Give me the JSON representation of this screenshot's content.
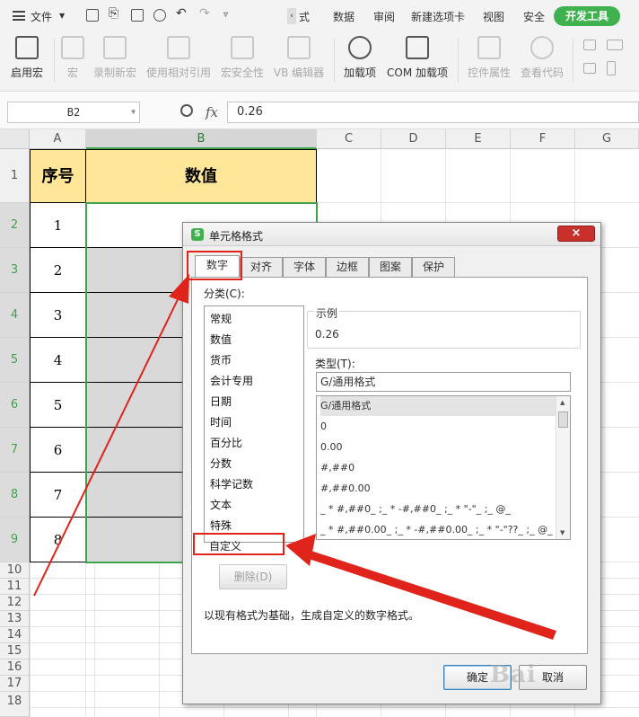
{
  "menubar": {
    "file_label": "文件",
    "tabs": [
      "式",
      "数据",
      "审阅",
      "新建选项卡",
      "视图",
      "安全"
    ],
    "active_tab": "开发工具"
  },
  "ribbon": {
    "buttons": [
      {
        "label": "启用宏",
        "enabled": true
      },
      {
        "label": "宏",
        "enabled": false
      },
      {
        "label": "录制新宏",
        "enabled": false
      },
      {
        "label": "使用相对引用",
        "enabled": false
      },
      {
        "label": "宏安全性",
        "enabled": false
      },
      {
        "label": "VB 编辑器",
        "enabled": false
      },
      {
        "label": "加载项",
        "enabled": true
      },
      {
        "label": "COM 加载项",
        "enabled": true
      },
      {
        "label": "控件属性",
        "enabled": false
      },
      {
        "label": "查看代码",
        "enabled": false
      }
    ]
  },
  "formula_bar": {
    "cell_ref": "B2",
    "fx_label": "fx",
    "value": "0.26"
  },
  "sheet": {
    "columns": [
      "A",
      "B",
      "C",
      "D",
      "E",
      "F",
      "G"
    ],
    "selected_column": "B",
    "header": {
      "a": "序号",
      "b": "数值"
    },
    "row_numbers": [
      "1",
      "2",
      "3",
      "4",
      "5",
      "6",
      "7",
      "8",
      "9",
      "10",
      "11",
      "12",
      "13",
      "14",
      "15",
      "16",
      "17",
      "18"
    ],
    "a_values": [
      "1",
      "2",
      "3",
      "4",
      "5",
      "6",
      "7",
      "8"
    ]
  },
  "dialog": {
    "title": "单元格格式",
    "close": "×",
    "tabs": [
      "数字",
      "对齐",
      "字体",
      "边框",
      "图案",
      "保护"
    ],
    "active_tab": "数字",
    "category_label": "分类(C):",
    "categories": [
      "常规",
      "数值",
      "货币",
      "会计专用",
      "日期",
      "时间",
      "百分比",
      "分数",
      "科学记数",
      "文本",
      "特殊",
      "自定义"
    ],
    "selected_category": "自定义",
    "sample_label": "示例",
    "sample_value": "0.26",
    "type_label": "类型(T):",
    "type_value": "G/通用格式",
    "type_list": [
      "G/通用格式",
      "0",
      "0.00",
      "#,##0",
      "#,##0.00",
      "_ * #,##0_ ;_ * -#,##0_ ;_ * \"-\"_ ;_ @_",
      "_ * #,##0.00_ ;_ * -#,##0.00_ ;_ * \"-\"??_ ;_ @_"
    ],
    "delete_button": "删除(D)",
    "description": "以现有格式为基础，生成自定义的数字格式。",
    "ok_button": "确定",
    "cancel_button": "取消"
  },
  "colors": {
    "accent_green": "#3fb24f",
    "header_fill": "#ffe699",
    "annotation_red": "#e0231b"
  },
  "watermark": "Bai"
}
